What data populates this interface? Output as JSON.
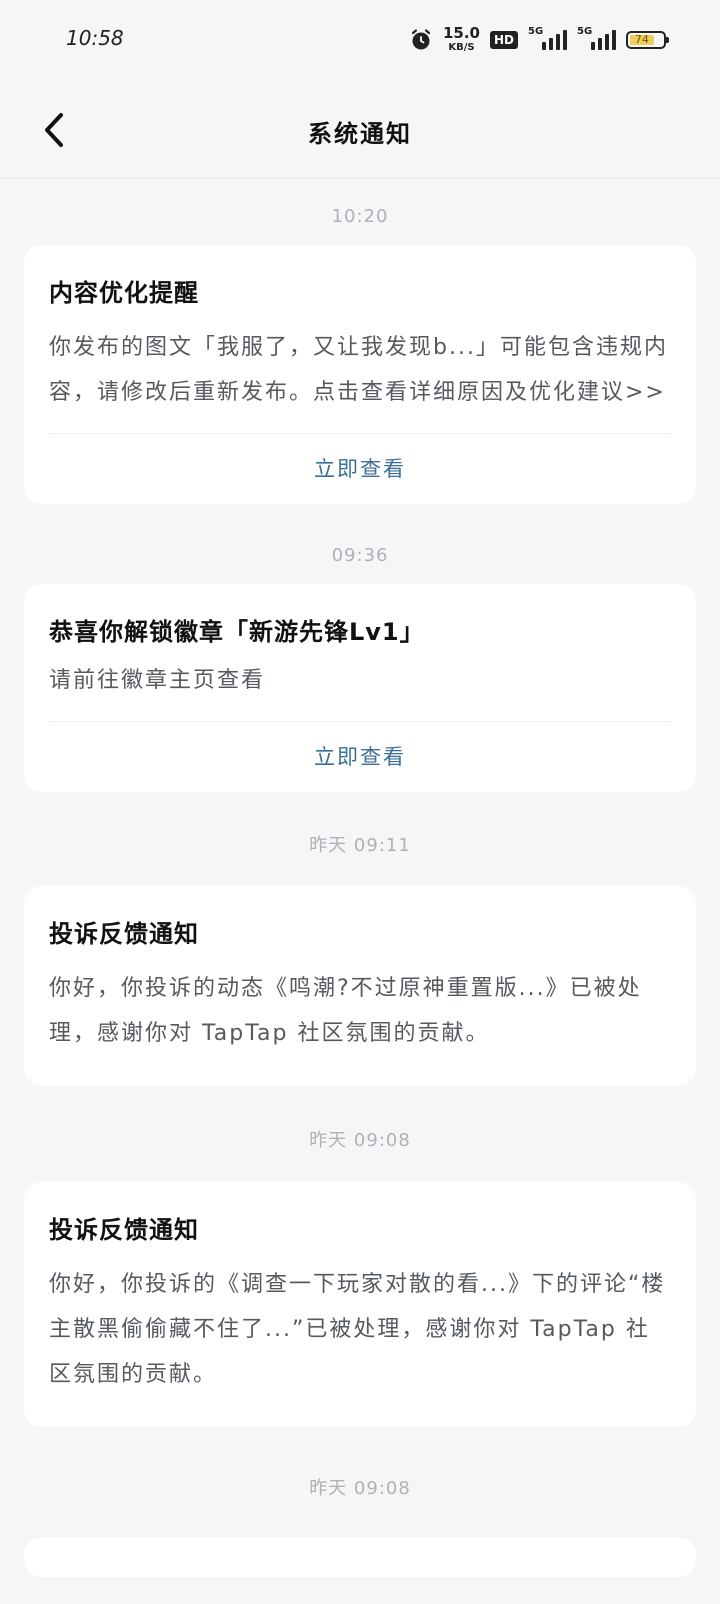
{
  "status_bar": {
    "time": "10:58",
    "net_speed_value": "15.0",
    "net_speed_unit": "KB/S",
    "hd_label": "HD",
    "sig1_label": "5G",
    "sig2_label": "5G",
    "battery_level": "74"
  },
  "header": {
    "title": "系统通知"
  },
  "notifications": [
    {
      "time": "10:20",
      "title": "内容优化提醒",
      "body": "你发布的图文「我服了，又让我发现b...」可能包含违规内容，请修改后重新发布。点击查看详细原因及优化建议>>",
      "action": "立即查看"
    },
    {
      "time": "09:36",
      "title": "恭喜你解锁徽章「新游先锋Lv1」",
      "body": "请前往徽章主页查看",
      "action": "立即查看"
    },
    {
      "time": "昨天  09:11",
      "title": "投诉反馈通知",
      "body": "你好，你投诉的动态《鸣潮?不过原神重置版...》已被处理，感谢你对 TapTap 社区氛围的贡献。"
    },
    {
      "time": "昨天  09:08",
      "title": "投诉反馈通知",
      "body": "你好，你投诉的《调查一下玩家对散的看...》下的评论“楼主散黑偷偷藏不住了...”已被处理，感谢你对 TapTap 社区氛围的贡献。"
    },
    {
      "time": "昨天  09:08"
    }
  ],
  "colors": {
    "background": "#f5f6f8",
    "card": "#ffffff",
    "action": "#3a6f98",
    "timestamp": "#aeb1b7"
  }
}
